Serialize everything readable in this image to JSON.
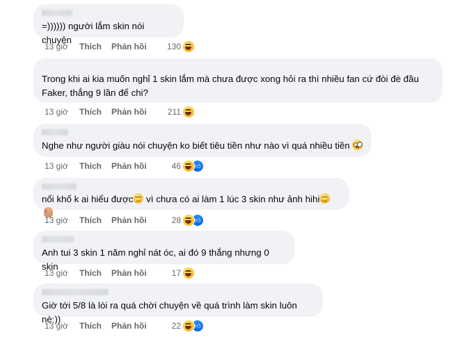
{
  "actions": {
    "like_label": "Thích",
    "reply_label": "Phản hồi"
  },
  "comments": [
    {
      "text": "=)))))) người lắm skin nói chuyện",
      "time": "13 giờ",
      "count": "130",
      "reactions": [
        "haha-icon"
      ]
    },
    {
      "text": "Trong khi ai kia muốn nghỉ 1 skin lắm mà chưa được xong hỏi ra thì nhiều fan cứ đòi đè đầu Faker, thắng 9 lần để chi?",
      "time": "13 giờ",
      "count": "211",
      "reactions": [
        "haha-icon"
      ]
    },
    {
      "text": "Nghe như người giàu nói chuyện ko biết tiêu tiền như nào vì quá nhiều tiền",
      "time": "13 giờ",
      "count": "46",
      "reactions": [
        "haha-icon",
        "like-icon"
      ],
      "inline_emoji": "flushed-face-icon"
    },
    {
      "text_part1": "nổi khổ k ai hiểu được",
      "text_part2": " vì chưa có ai làm 1 lúc 3 skin như ảnh hihi",
      "time": "13 giờ",
      "count": "28",
      "reactions": [
        "haha-icon",
        "like-icon"
      ],
      "inline_emoji": [
        "relieved-face-icon",
        "smiling-face-icon",
        "waving-hand-icon"
      ]
    },
    {
      "text": "Anh tui 3 skin 1 năm nghỉ nát óc, ai đó 9 thắng nhưng 0 skin",
      "time": "13 giờ",
      "count": "17",
      "reactions": [
        "haha-icon"
      ]
    },
    {
      "text": "Giờ tới 5/8 là lòi ra quá chời chuyện về quá trình làm skin luôn nè:))",
      "time": "13 giờ",
      "count": "22",
      "reactions": [
        "haha-icon",
        "like-icon"
      ]
    }
  ]
}
